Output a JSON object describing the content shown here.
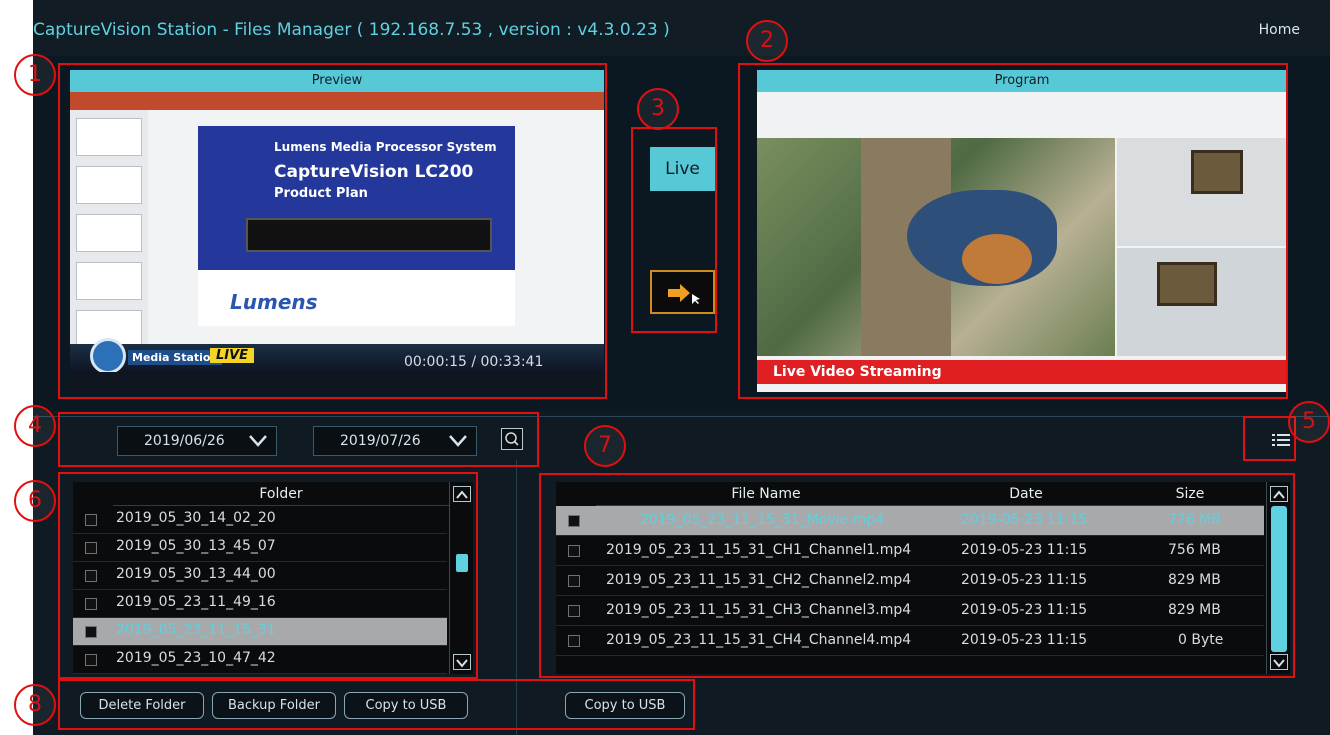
{
  "header": {
    "title": "CaptureVision Station - Files Manager ( 192.168.7.53 , version : v4.3.0.23 )",
    "home_label": "Home"
  },
  "markers": [
    "1",
    "2",
    "3",
    "4",
    "5",
    "6",
    "7",
    "8"
  ],
  "preview": {
    "title": "Preview",
    "slide": {
      "line1": "Lumens Media Processor System",
      "line2": "CaptureVision LC200",
      "line3": "Product Plan",
      "logo": "Lumens"
    },
    "media_station_label": "Media Station",
    "live_tag": "LIVE",
    "timecode": "00:00:15 / 00:33:41"
  },
  "program": {
    "title": "Program",
    "banner": "Live Video Streaming"
  },
  "live_controls": {
    "live_label": "Live"
  },
  "date_filter": {
    "from": "2019/06/26",
    "to": "2019/07/26"
  },
  "folders": {
    "header": "Folder",
    "rows": [
      {
        "name": "2019_05_30_14_02_20",
        "selected": false
      },
      {
        "name": "2019_05_30_13_45_07",
        "selected": false
      },
      {
        "name": "2019_05_30_13_44_00",
        "selected": false
      },
      {
        "name": "2019_05_23_11_49_16",
        "selected": false
      },
      {
        "name": "2019_05_23_11_15_31",
        "selected": true
      },
      {
        "name": "2019_05_23_10_47_42",
        "selected": false
      }
    ]
  },
  "files": {
    "columns": [
      "File Name",
      "Date",
      "Size"
    ],
    "rows": [
      {
        "name": "2019_05_23_11_15_31_Movie.mp4",
        "date": "2019-05-23 11:15",
        "size": "776 MB",
        "selected": true
      },
      {
        "name": "2019_05_23_11_15_31_CH1_Channel1.mp4",
        "date": "2019-05-23 11:15",
        "size": "756 MB",
        "selected": false
      },
      {
        "name": "2019_05_23_11_15_31_CH2_Channel2.mp4",
        "date": "2019-05-23 11:15",
        "size": "829 MB",
        "selected": false
      },
      {
        "name": "2019_05_23_11_15_31_CH3_Channel3.mp4",
        "date": "2019-05-23 11:15",
        "size": "829 MB",
        "selected": false
      },
      {
        "name": "2019_05_23_11_15_31_CH4_Channel4.mp4",
        "date": "2019-05-23 11:15",
        "size": "0 Byte",
        "selected": false
      }
    ]
  },
  "buttons": {
    "delete_folder": "Delete Folder",
    "backup_folder": "Backup Folder",
    "copy_to_usb_folders": "Copy to USB",
    "copy_to_usb_files": "Copy to USB"
  },
  "colors": {
    "accent": "#5fd1e0",
    "marker": "#e01010",
    "background": "#0f1a22",
    "banner_red": "#e01f22"
  }
}
